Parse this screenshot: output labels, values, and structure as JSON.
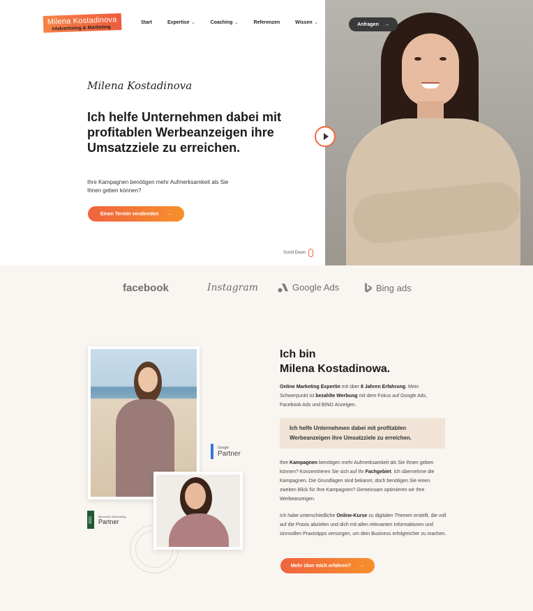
{
  "header": {
    "logo_name": "Milena Kostadinova",
    "logo_tagline": "#Advertising & Marketing",
    "nav": [
      {
        "label": "Start",
        "dropdown": false
      },
      {
        "label": "Expertise",
        "dropdown": true
      },
      {
        "label": "Coaching",
        "dropdown": true
      },
      {
        "label": "Referenzen",
        "dropdown": false
      },
      {
        "label": "Wissen",
        "dropdown": true
      }
    ],
    "cta": "Anfragen",
    "cta_arrow": "→"
  },
  "hero": {
    "signature": "Milena Kostadinova",
    "headline": "Ich helfe Unternehmen dabei mit profitablen Werbeanzeigen ihre Umsatzziele zu erreichen.",
    "subline": "Ihre Kampagnen benötigen mehr Aufmerksamkeit als Sie Ihnen geben können?",
    "button": "Einen Termin verabreden",
    "button_arrow": "→",
    "scroll_label": "Scroll Down"
  },
  "brands": [
    "facebook",
    "Instagram",
    "Google Ads",
    "Bing ads"
  ],
  "badges": {
    "google_small": "Google",
    "google_big": "Partner",
    "microsoft_year": "2021",
    "microsoft_small": "Microsoft | Advertising",
    "microsoft_big": "Partner"
  },
  "about": {
    "heading_line1": "Ich bin",
    "heading_line2": "Milena Kostadinowa.",
    "p1_b1": "Online Marketing Expertin",
    "p1_t1": " mit über ",
    "p1_b2": "8 Jahren Erfahrung",
    "p1_t2": ". Mein Schwerpunkt ist ",
    "p1_b3": "bezahlte Werbung",
    "p1_t3": " mit dem Fokus auf Google Ads, Facebook Ads und BING Anzeigen.",
    "quote": "Ich helfe Unternehmen dabei mit profitablen Werbeanzeigen ihre Umsatzziele zu erreichen.",
    "p2_t1": "Ihre ",
    "p2_b1": "Kampagnen",
    "p2_t2": " benötigen mehr Aufmerksamkeit als Sie Ihnen geben können? Konzentrieren Sie sich auf Ihr ",
    "p2_b2": "Fachgebiet",
    "p2_t3": ". Ich übernehme die Kampagnen. Die Grundlagen sind bekannt, doch benötigen Sie einen zweiten Blick für Ihre Kampagnen? Gemeinsam optimieren wir Ihre Werbeanzeigen.",
    "p3_t1": "Ich habe unterschiedliche ",
    "p3_b1": "Online-Kurse",
    "p3_t2": " zu digitalen Themen erstellt, die voll auf die Praxis abzielen und dich mit allen relevanten Informationen und sinnvollen Praxistipps versorgen, um dein Business erfolgreicher zu machen.",
    "button": "Mehr über mich erfahren?",
    "button_arrow": "→"
  }
}
